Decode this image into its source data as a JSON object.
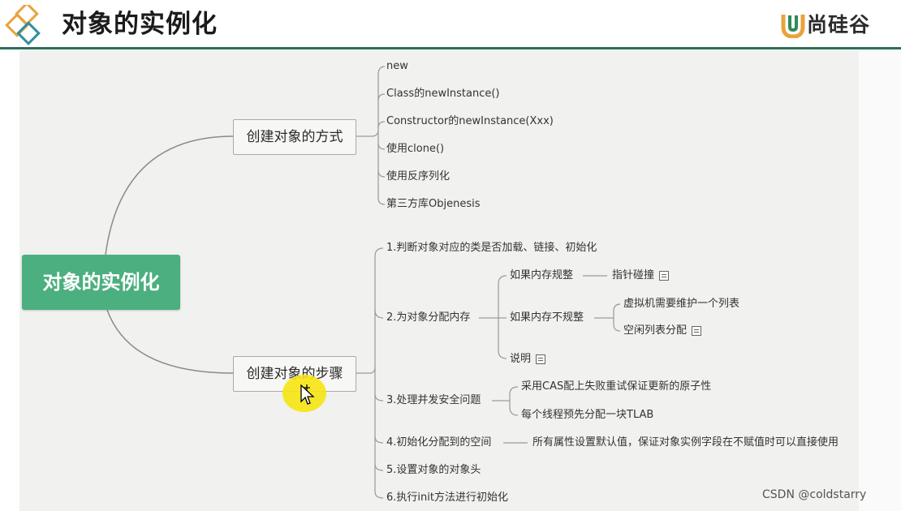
{
  "header": {
    "title": "对象的实例化",
    "brand_name": "尚硅谷",
    "accent_color": "#2f6e5c",
    "logo_icon": "stacked-diamonds-icon",
    "brand_icon": "u-shield-icon"
  },
  "mindmap": {
    "root": "对象的实例化",
    "root_color": "#4caf7f",
    "branches": [
      {
        "label": "创建对象的方式",
        "children": [
          "new",
          "Class的newInstance()",
          "Constructor的newInstance(Xxx)",
          "使用clone()",
          "使用反序列化",
          "第三方库Objenesis"
        ]
      },
      {
        "label": "创建对象的步骤",
        "steps": [
          {
            "label": "1.判断对象对应的类是否加载、链接、初始化"
          },
          {
            "label": "2.为对象分配内存",
            "children": [
              {
                "label": "如果内存规整",
                "detail": "指针碰撞",
                "note_icon": "note-icon"
              },
              {
                "label": "如果内存不规整",
                "children": [
                  {
                    "label": "虚拟机需要维护一个列表"
                  },
                  {
                    "label": "空闲列表分配",
                    "note_icon": "note-icon"
                  }
                ]
              },
              {
                "label": "说明",
                "note_icon": "note-icon"
              }
            ]
          },
          {
            "label": "3.处理并发安全问题",
            "children": [
              {
                "label": "采用CAS配上失败重试保证更新的原子性"
              },
              {
                "label": "每个线程预先分配一块TLAB"
              }
            ]
          },
          {
            "label": "4.初始化分配到的空间",
            "detail": "所有属性设置默认值，保证对象实例字段在不赋值时可以直接使用"
          },
          {
            "label": "5.设置对象的对象头"
          },
          {
            "label": "6.执行init方法进行初始化"
          }
        ]
      }
    ]
  },
  "cursor": {
    "icon": "move-cursor-icon",
    "highlight_color": "#f6e412"
  },
  "watermark": "CSDN @coldstarry"
}
